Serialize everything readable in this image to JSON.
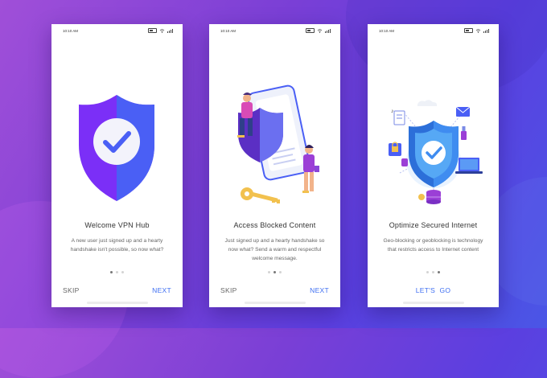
{
  "colors": {
    "accent": "#3f6ff2",
    "shield_left": "#7b2ff7",
    "shield_right": "#4a5ff5"
  },
  "screens": [
    {
      "status": {
        "time": "10:10 AM"
      },
      "illustration": "shield-check-icon",
      "title": "Welcome VPN Hub",
      "body": "A new user just signed up and a hearty handshake isn't possible, so now what?",
      "page_indicator": {
        "current": 1,
        "total": 3
      },
      "skip_label": "SKIP",
      "next_label": "NEXT"
    },
    {
      "status": {
        "time": "10:10 AM"
      },
      "illustration": "blocked-content-people-icon",
      "title": "Access Blocked Content",
      "body": "Just signed up and a hearty handshake  so now what? Send a warm and respectful welcome message.",
      "page_indicator": {
        "current": 2,
        "total": 3
      },
      "skip_label": "SKIP",
      "next_label": "NEXT"
    },
    {
      "status": {
        "time": "10:10 AM"
      },
      "illustration": "secure-internet-network-icon",
      "title": "Optimize Secured Internet",
      "body": "Geo-blocking or geoblocking is technology that restricts access to Internet content",
      "page_indicator": {
        "current": 3,
        "total": 3
      },
      "cta_label": "LET'S  GO"
    }
  ]
}
